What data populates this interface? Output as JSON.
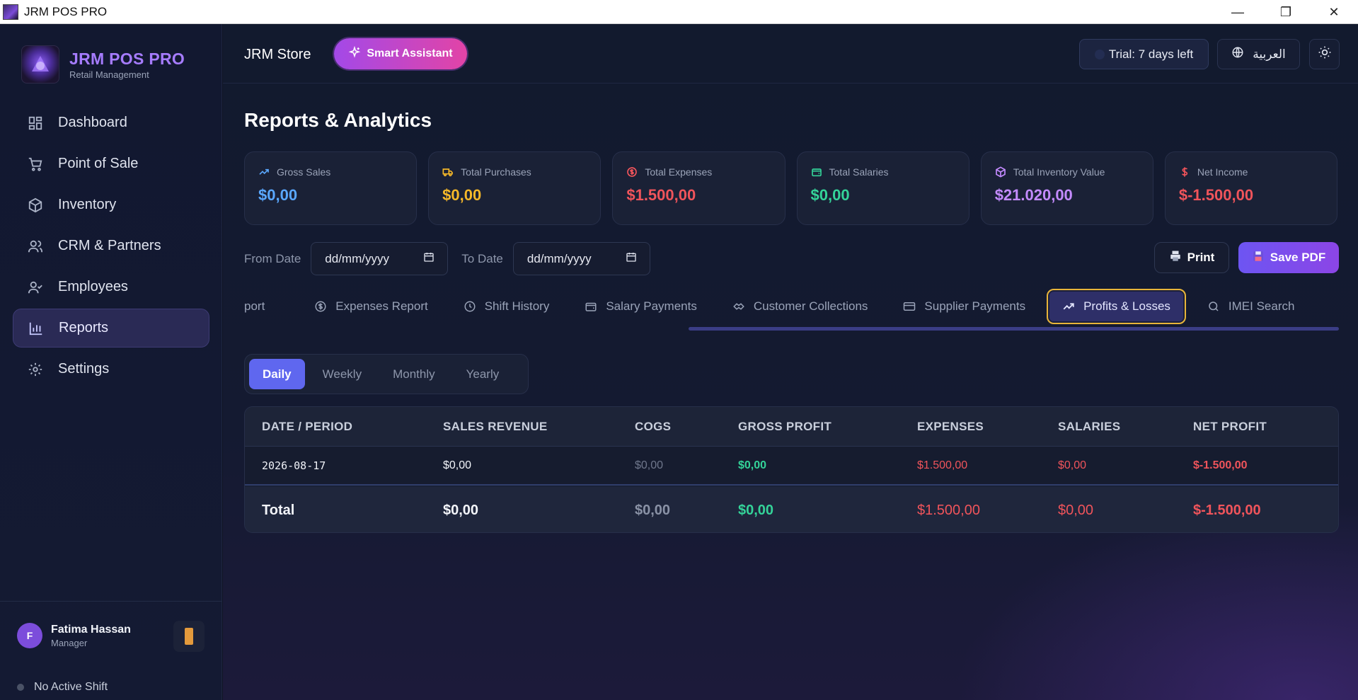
{
  "window": {
    "title": "JRM POS PRO",
    "minimize": "—",
    "maximize": "❐",
    "close": "✕"
  },
  "brand": {
    "name": "JRM POS PRO",
    "subtitle": "Retail Management"
  },
  "sidebar": {
    "items": [
      {
        "label": "Dashboard",
        "icon": "dashboard-icon"
      },
      {
        "label": "Point of Sale",
        "icon": "cart-icon"
      },
      {
        "label": "Inventory",
        "icon": "box-icon"
      },
      {
        "label": "CRM & Partners",
        "icon": "users-icon"
      },
      {
        "label": "Employees",
        "icon": "user-check-icon"
      },
      {
        "label": "Reports",
        "icon": "bar-chart-icon",
        "active": true
      },
      {
        "label": "Settings",
        "icon": "gear-icon"
      }
    ],
    "user": {
      "initial": "F",
      "name": "Fatima Hassan",
      "role": "Manager"
    },
    "shift_status": "No Active Shift"
  },
  "topbar": {
    "store": "JRM Store",
    "assistant": "Smart Assistant",
    "trial": "Trial: 7 days left",
    "language": "العربية"
  },
  "page": {
    "title": "Reports & Analytics"
  },
  "stats": [
    {
      "label": "Gross Sales",
      "value": "$0,00",
      "color": "#5aa8ff",
      "icon": "trending-up-icon"
    },
    {
      "label": "Total Purchases",
      "value": "$0,00",
      "color": "#f5b829",
      "icon": "truck-icon"
    },
    {
      "label": "Total Expenses",
      "value": "$1.500,00",
      "color": "#f0545b",
      "icon": "dollar-circle-icon"
    },
    {
      "label": "Total Salaries",
      "value": "$0,00",
      "color": "#34d399",
      "icon": "wallet-icon"
    },
    {
      "label": "Total Inventory Value",
      "value": "$21.020,00",
      "color": "#c48bff",
      "icon": "cube-icon"
    },
    {
      "label": "Net Income",
      "value": "$-1.500,00",
      "color": "#f0545b",
      "icon": "dollar-icon"
    }
  ],
  "filters": {
    "from_label": "From Date",
    "from_placeholder": "dd/mm/yyyy",
    "to_label": "To Date",
    "to_placeholder": "dd/mm/yyyy"
  },
  "actions": {
    "print": "Print",
    "save_pdf": "Save PDF"
  },
  "tabs": [
    {
      "label": "port"
    },
    {
      "label": "Expenses Report"
    },
    {
      "label": "Shift History"
    },
    {
      "label": "Salary Payments"
    },
    {
      "label": "Customer Collections"
    },
    {
      "label": "Supplier Payments"
    },
    {
      "label": "Profits & Losses",
      "active": true
    },
    {
      "label": "IMEI Search"
    }
  ],
  "periods": [
    "Daily",
    "Weekly",
    "Monthly",
    "Yearly"
  ],
  "active_period": "Daily",
  "table": {
    "headers": [
      "DATE / PERIOD",
      "SALES REVENUE",
      "COGS",
      "GROSS PROFIT",
      "EXPENSES",
      "SALARIES",
      "NET PROFIT"
    ],
    "rows": [
      [
        "2026-08-17",
        "$0,00",
        "$0,00",
        "$0,00",
        "$1.500,00",
        "$0,00",
        "$-1.500,00"
      ]
    ],
    "total": [
      "Total",
      "$0,00",
      "$0,00",
      "$0,00",
      "$1.500,00",
      "$0,00",
      "$-1.500,00"
    ]
  }
}
